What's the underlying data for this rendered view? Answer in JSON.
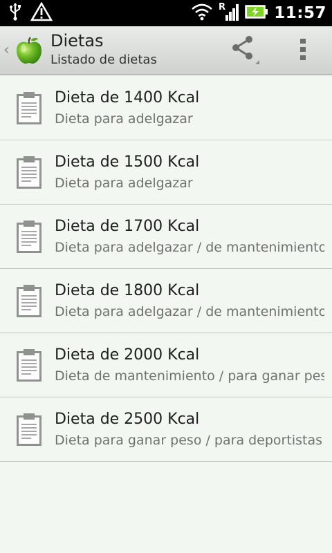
{
  "status_bar": {
    "time": "11:57",
    "icons": [
      "usb-icon",
      "warning-icon",
      "wifi-icon",
      "roaming-signal-icon",
      "battery-charging-icon"
    ]
  },
  "action_bar": {
    "back_glyph": "‹",
    "title": "Dietas",
    "subtitle": "Listado de dietas",
    "icons": [
      "apple-logo",
      "share-icon",
      "overflow-menu-icon"
    ]
  },
  "diets": [
    {
      "title": "Dieta de 1400 Kcal",
      "subtitle": "Dieta para adelgazar"
    },
    {
      "title": "Dieta de 1500 Kcal",
      "subtitle": "Dieta para adelgazar"
    },
    {
      "title": "Dieta de 1700 Kcal",
      "subtitle": "Dieta para adelgazar / de mantenimiento"
    },
    {
      "title": "Dieta de 1800 Kcal",
      "subtitle": "Dieta para adelgazar / de mantenimiento"
    },
    {
      "title": "Dieta de 2000 Kcal",
      "subtitle": "Dieta de mantenimiento / para ganar peso"
    },
    {
      "title": "Dieta de 2500 Kcal",
      "subtitle": "Dieta para ganar peso / para deportistas"
    }
  ],
  "colors": {
    "background": "#f3f7f2",
    "status_bar": "#000000",
    "divider": "#c6c9c5",
    "battery": "#7ed321"
  }
}
